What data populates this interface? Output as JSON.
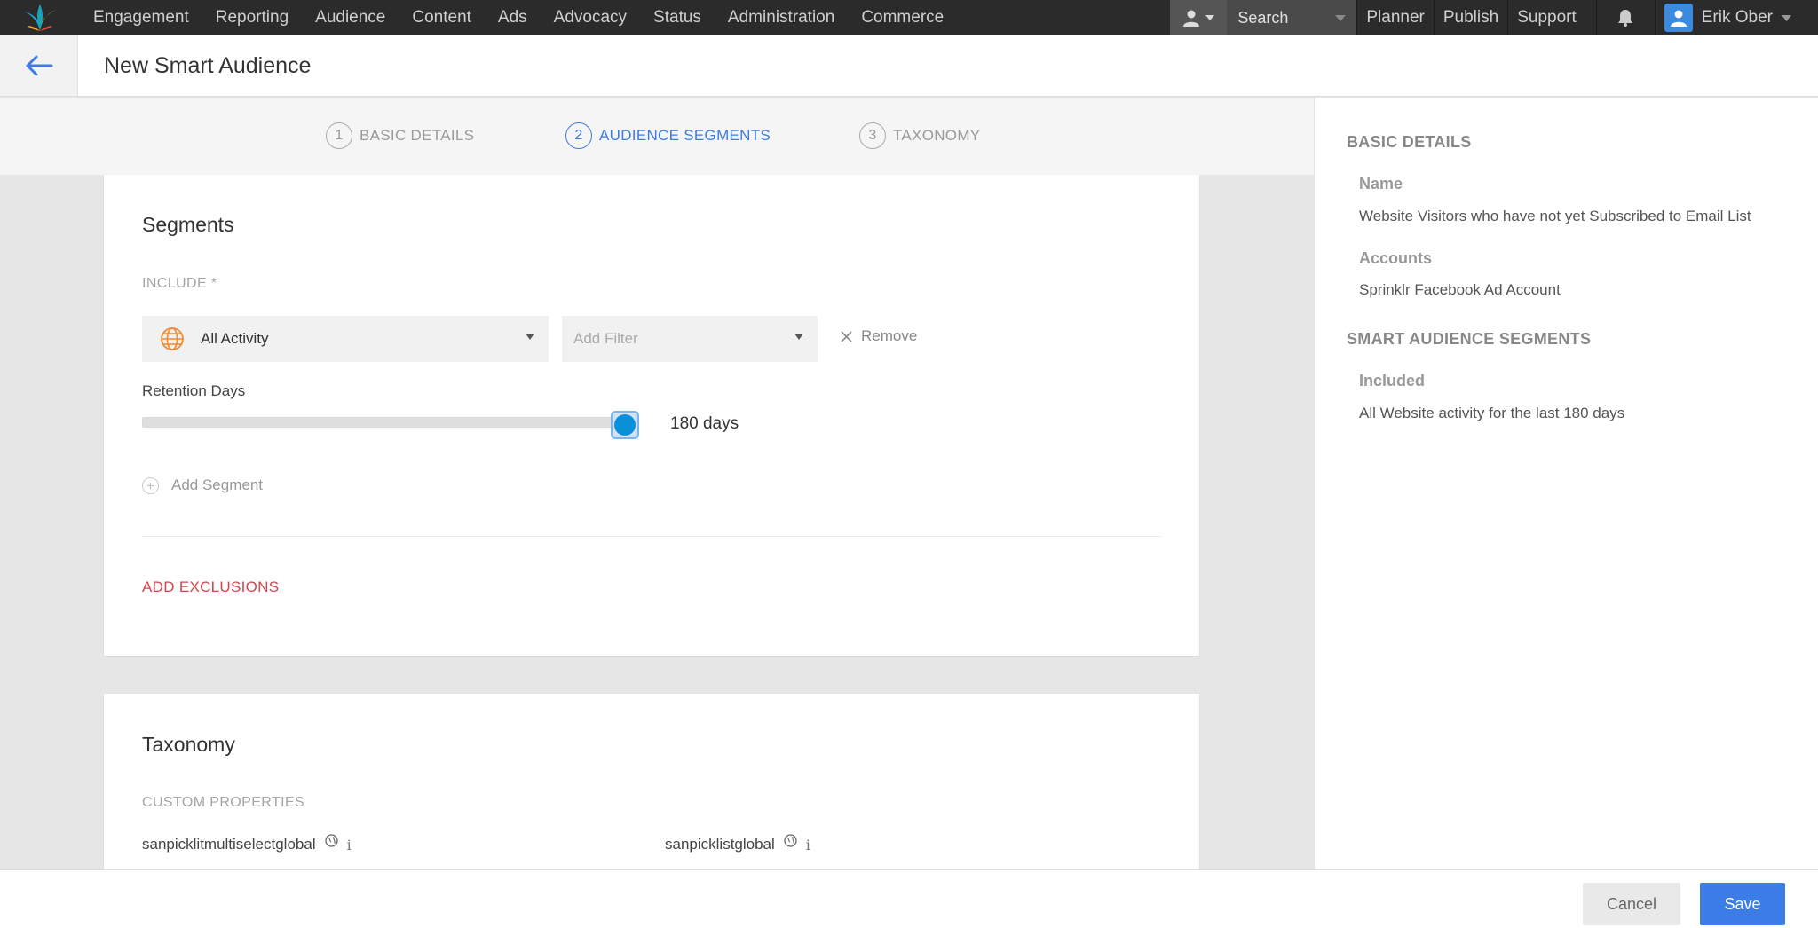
{
  "nav": {
    "items": [
      "Engagement",
      "Reporting",
      "Audience",
      "Content",
      "Ads",
      "Advocacy",
      "Status",
      "Administration",
      "Commerce"
    ],
    "search_label": "Search",
    "right_links": [
      "Planner",
      "Publish",
      "Support"
    ],
    "user_name": "Erik Ober"
  },
  "header": {
    "title": "New Smart Audience"
  },
  "stepper": {
    "steps": [
      {
        "num": "1",
        "label": "BASIC DETAILS"
      },
      {
        "num": "2",
        "label": "AUDIENCE SEGMENTS"
      },
      {
        "num": "3",
        "label": "TAXONOMY"
      }
    ],
    "active_step": 2
  },
  "segments": {
    "title": "Segments",
    "include_label": "INCLUDE *",
    "activity_value": "All Activity",
    "filter_placeholder": "Add Filter",
    "remove_label": "Remove",
    "retention_label": "Retention Days",
    "retention_value_text": "180 days",
    "retention_fraction": 1.0,
    "add_segment_label": "Add Segment",
    "add_exclusions_label": "ADD EXCLUSIONS"
  },
  "taxonomy": {
    "title": "Taxonomy",
    "custom_label": "CUSTOM PROPERTIES",
    "properties": [
      "sanpicklitmultiselectglobal",
      "sanpicklistglobal"
    ]
  },
  "summary": {
    "basic_details_heading": "BASIC DETAILS",
    "name_label": "Name",
    "name_value": "Website Visitors who have not yet Subscribed to Email List",
    "accounts_label": "Accounts",
    "accounts_value": "Sprinklr Facebook Ad Account",
    "segments_heading": "SMART AUDIENCE SEGMENTS",
    "included_label": "Included",
    "included_value": "All Website activity for the last 180 days"
  },
  "footer": {
    "cancel_label": "Cancel",
    "save_label": "Save"
  },
  "colors": {
    "accent": "#3b7ce6",
    "danger": "#d5454e",
    "slider_thumb": "#0a90d8"
  }
}
